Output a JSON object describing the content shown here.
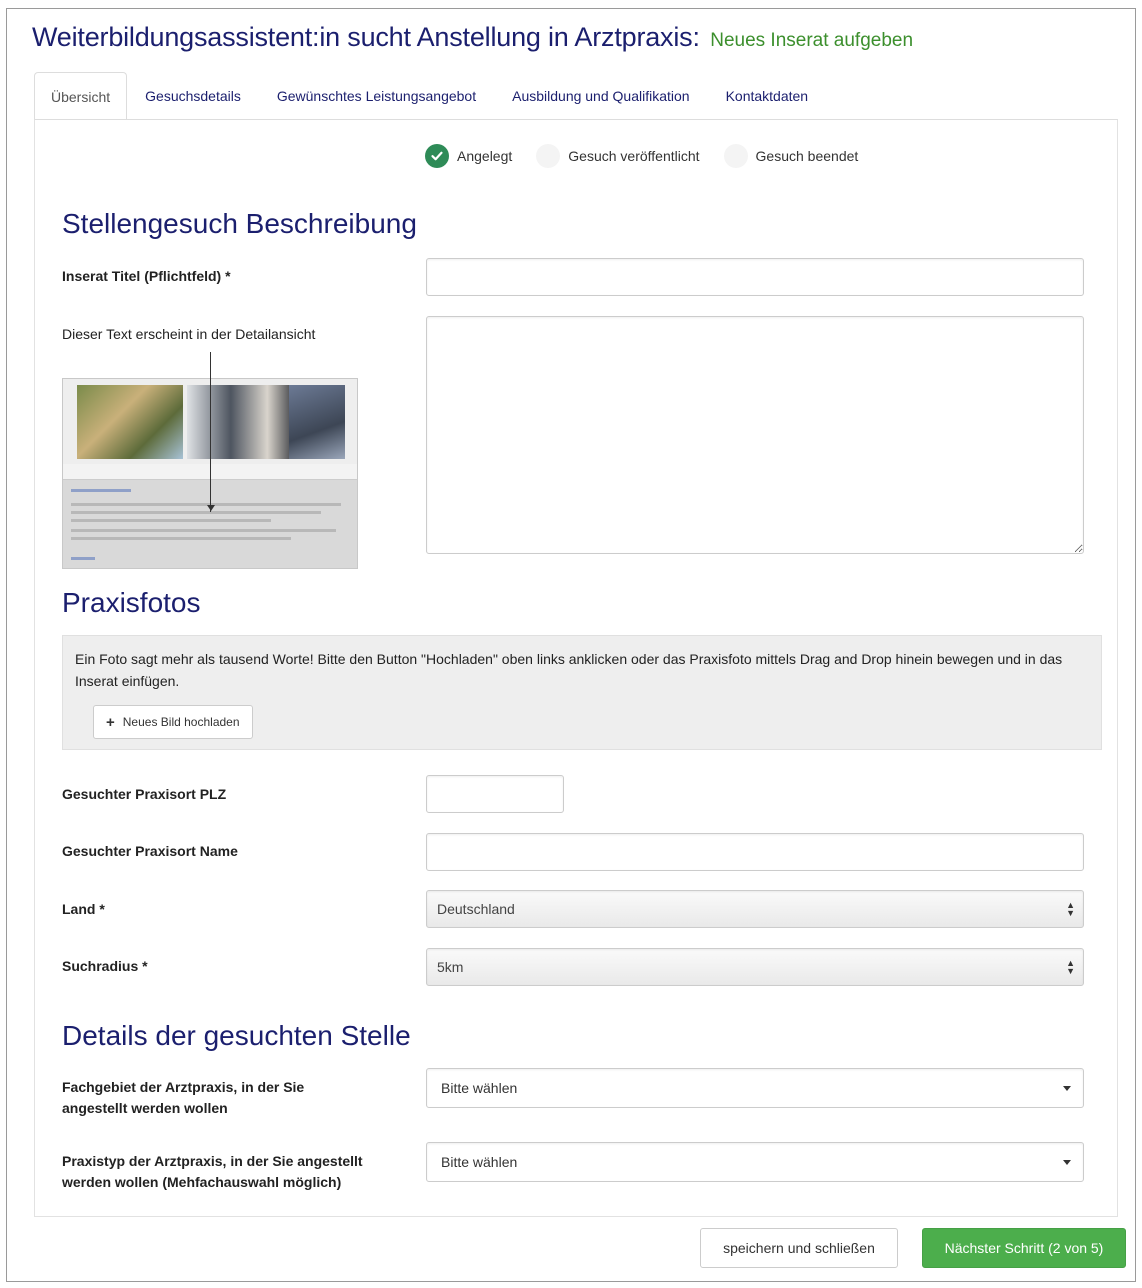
{
  "header": {
    "title": "Weiterbildungsassistent:in sucht Anstellung in Arztpraxis:",
    "subtitle": "Neues Inserat aufgeben"
  },
  "tabs": [
    {
      "label": "Übersicht",
      "active": true
    },
    {
      "label": "Gesuchsdetails",
      "active": false
    },
    {
      "label": "Gewünschtes Leistungsangebot",
      "active": false
    },
    {
      "label": "Ausbildung und Qualifikation",
      "active": false
    },
    {
      "label": "Kontaktdaten",
      "active": false
    }
  ],
  "status_steps": [
    {
      "label": "Angelegt",
      "done": true
    },
    {
      "label": "Gesuch veröffentlicht",
      "done": false
    },
    {
      "label": "Gesuch beendet",
      "done": false
    }
  ],
  "sections": {
    "description": {
      "heading": "Stellengesuch Beschreibung",
      "title_label": "Inserat Titel (Pflichtfeld) *",
      "title_value": "",
      "text_hint": "Dieser Text erscheint in der Detailansicht",
      "text_value": ""
    },
    "photos": {
      "heading": "Praxisfotos",
      "info": "Ein Foto sagt mehr als tausend Worte! Bitte den Button \"Hochladen\" oben links anklicken oder das Praxisfoto mittels Drag and Drop hinein bewegen und in das Inserat einfügen.",
      "upload_label": "Neues Bild hochladen"
    },
    "location": {
      "plz_label": "Gesuchter Praxisort PLZ",
      "plz_value": "",
      "name_label": "Gesuchter Praxisort Name",
      "name_value": "",
      "country_label": "Land *",
      "country_value": "Deutschland",
      "radius_label": "Suchradius *",
      "radius_value": "5km"
    },
    "details": {
      "heading": "Details der gesuchten Stelle",
      "field_label": "Fachgebiet der Arztpraxis, in der Sie angestellt werden wollen",
      "field_value": "Bitte wählen",
      "type_label": "Praxistyp der Arztpraxis, in der Sie angestellt werden wollen (Mehfachauswahl möglich)",
      "type_value": "Bitte wählen"
    }
  },
  "actions": {
    "save_label": "speichern und schließen",
    "next_label": "Nächster Schritt (2 von 5)"
  },
  "colors": {
    "heading": "#1b1f6e",
    "subtitle": "#3c8f2d",
    "next_button": "#4cae4c",
    "step_done": "#2e8b57"
  }
}
